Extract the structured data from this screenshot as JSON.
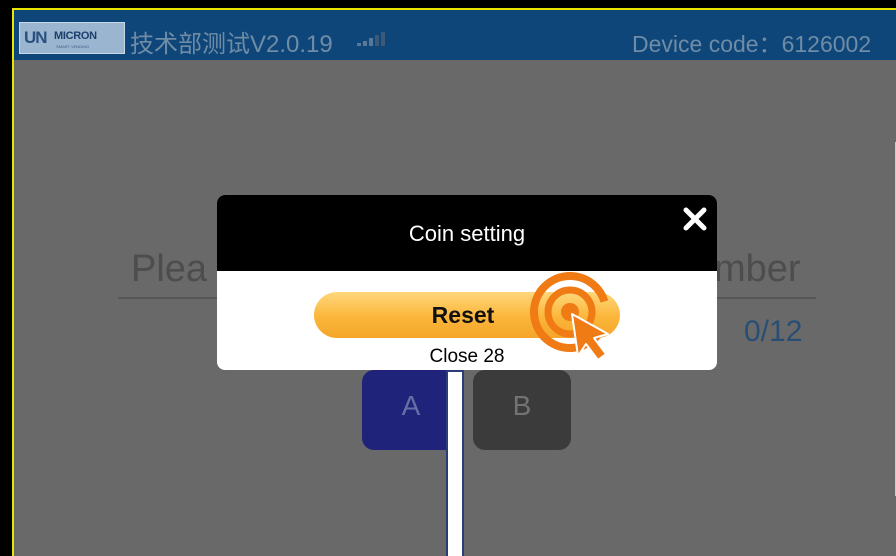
{
  "header": {
    "logo_mark": "UN",
    "logo_brand": "MICRON",
    "logo_tagline": "SMART VENDING",
    "title": "技术部测试V2.0.19",
    "device_code": "Device code：6126002",
    "signal_icon": "signal-bars-icon"
  },
  "background": {
    "input_placeholder_left": "Plea",
    "input_placeholder_right": "mber",
    "counter": "0/12",
    "keys": [
      "A",
      "B"
    ]
  },
  "dialog": {
    "title": "Coin setting",
    "close_icon": "close-icon",
    "reset_label": "Reset",
    "status_text": "Close 28"
  },
  "overlay": {
    "pointer_icon": "tap-pointer-icon"
  },
  "colors": {
    "topbar": "#0f4679",
    "dim_background": "#696969",
    "accent_orange": "#fbb63a",
    "frame_yellow": "#e6e600",
    "key_a": "#1f237a",
    "key_b": "#3b3b3b"
  }
}
